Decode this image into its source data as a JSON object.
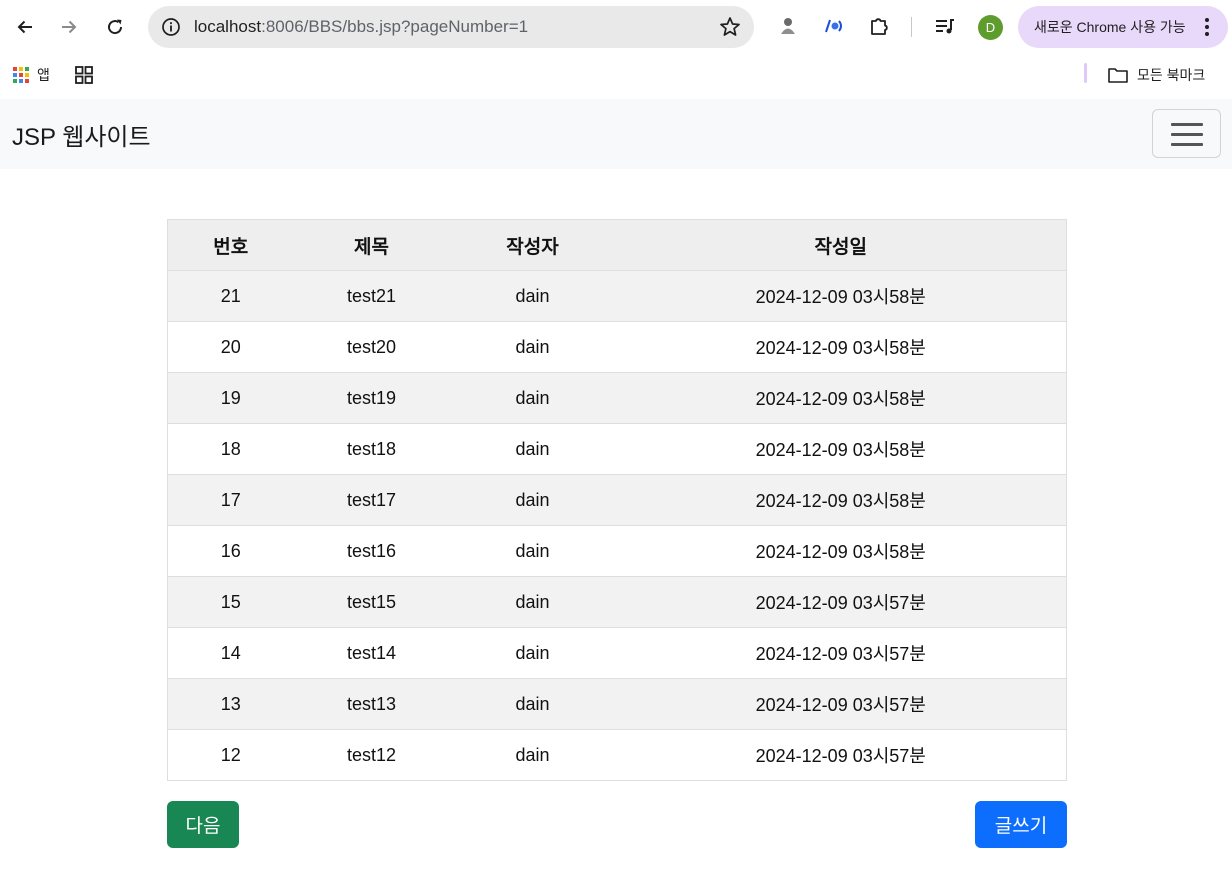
{
  "browser": {
    "url_host": "localhost",
    "url_rest": ":8006/BBS/bbs.jsp?pageNumber=1",
    "avatar_letter": "D",
    "update_label": "새로운 Chrome 사용 가능"
  },
  "bookmarks": {
    "apps_label": "앱",
    "all_bookmarks_label": "모든 북마크"
  },
  "navbar": {
    "brand": "JSP 웹사이트"
  },
  "board": {
    "headers": [
      "번호",
      "제목",
      "작성자",
      "작성일"
    ],
    "rows": [
      {
        "no": "21",
        "title": "test21",
        "author": "dain",
        "date": "2024-12-09 03시58분"
      },
      {
        "no": "20",
        "title": "test20",
        "author": "dain",
        "date": "2024-12-09 03시58분"
      },
      {
        "no": "19",
        "title": "test19",
        "author": "dain",
        "date": "2024-12-09 03시58분"
      },
      {
        "no": "18",
        "title": "test18",
        "author": "dain",
        "date": "2024-12-09 03시58분"
      },
      {
        "no": "17",
        "title": "test17",
        "author": "dain",
        "date": "2024-12-09 03시58분"
      },
      {
        "no": "16",
        "title": "test16",
        "author": "dain",
        "date": "2024-12-09 03시58분"
      },
      {
        "no": "15",
        "title": "test15",
        "author": "dain",
        "date": "2024-12-09 03시57분"
      },
      {
        "no": "14",
        "title": "test14",
        "author": "dain",
        "date": "2024-12-09 03시57분"
      },
      {
        "no": "13",
        "title": "test13",
        "author": "dain",
        "date": "2024-12-09 03시57분"
      },
      {
        "no": "12",
        "title": "test12",
        "author": "dain",
        "date": "2024-12-09 03시57분"
      }
    ]
  },
  "actions": {
    "next_label": "다음",
    "write_label": "글쓰기"
  },
  "colors": {
    "next_button": "#198754",
    "write_button": "#0d6efd",
    "update_pill": "#e8d8fa",
    "navbar_bg": "#f8f9fa"
  },
  "icons": [
    "back-arrow-icon",
    "forward-arrow-icon",
    "reload-icon",
    "site-info-icon",
    "star-icon",
    "extension-icon",
    "puzzle-icon",
    "media-control-icon",
    "kebab-menu-icon",
    "apps-grid-icon",
    "tab-groups-icon",
    "folder-icon",
    "hamburger-icon"
  ]
}
